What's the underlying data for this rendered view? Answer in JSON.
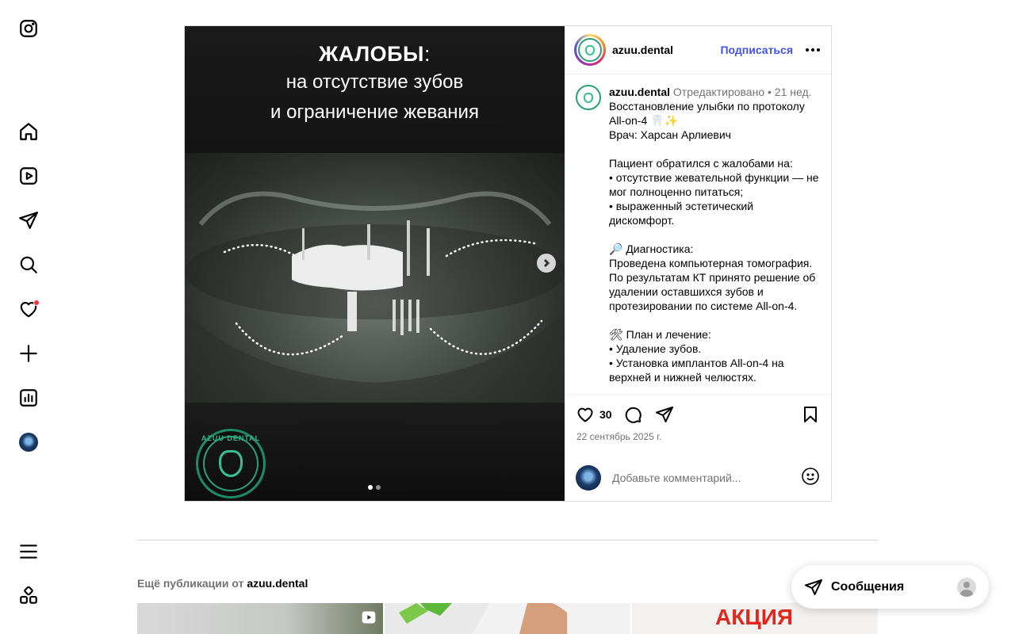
{
  "nav": {
    "items": [
      {
        "icon": "instagram-logo-icon"
      },
      {
        "icon": "home-icon"
      },
      {
        "icon": "reels-icon"
      },
      {
        "icon": "direct-icon"
      },
      {
        "icon": "search-icon"
      },
      {
        "icon": "notifications-icon",
        "has_dot": true
      },
      {
        "icon": "create-icon"
      },
      {
        "icon": "insights-icon"
      },
      {
        "icon": "profile-avatar"
      },
      {
        "icon": "menu-icon"
      },
      {
        "icon": "also-from-meta-icon"
      }
    ]
  },
  "post": {
    "username": "azuu.dental",
    "follow_label": "Подписаться",
    "media": {
      "heading": "ЖАЛОБЫ",
      "heading_colon": ":",
      "subheading_line1": "на отсутствие зубов",
      "subheading_line2": "и ограничение жевания",
      "logo_text": "AZUU DENTAL",
      "slide_count": 2,
      "active_slide": 1
    },
    "caption": {
      "username": "azuu.dental",
      "edited": "Отредактировано",
      "separator": "•",
      "time": "21 нед.",
      "text": "Восстановление улыбки по протоколу All-on-4 🦷✨\nВрач: Харсан Арлиевич\n\nПациент обратился с жалобами на:\n• отсутствие жевательной функции — не мог полноценно питаться;\n• выраженный эстетический дискомфорт.\n\n🔎 Диагностика:\nПроведена компьютерная томография. По результатам КТ принято решение об удалении оставшихся зубов и протезировании по системе All-on-4.\n\n🛠 План и лечение:\n• Удаление зубов.\n• Установка имплантов All-on-4 на верхней и нижней челюстях."
    },
    "likes": "30",
    "date": "22 сентябрь 2025 г.",
    "comment_placeholder": "Добавьте комментарий..."
  },
  "more_posts": {
    "prefix": "Ещё публикации от",
    "username": "azuu.dental",
    "thumb3_text": "АКЦИЯ"
  },
  "messages": {
    "label": "Сообщения"
  }
}
